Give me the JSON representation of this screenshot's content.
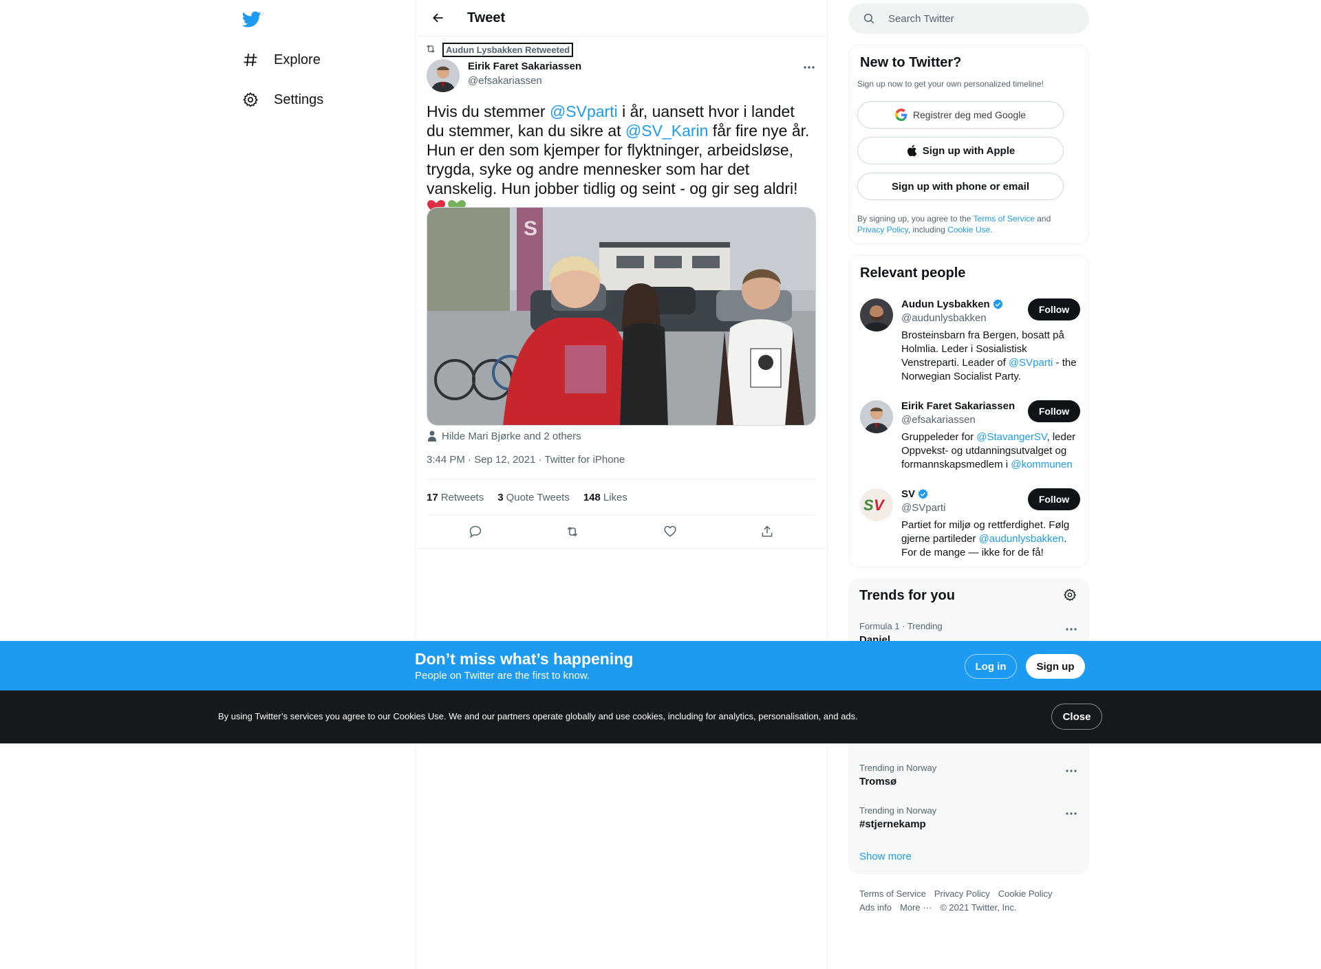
{
  "nav": {
    "logo": "twitter-bird-icon",
    "items": [
      {
        "label": "Explore",
        "icon": "hashtag-icon"
      },
      {
        "label": "Settings",
        "icon": "gear-icon"
      }
    ]
  },
  "header": {
    "title": "Tweet"
  },
  "tweet": {
    "retweeted_by": "Audun Lysbakken Retweeted",
    "author_name": "Eirik Faret Sakariassen",
    "author_handle": "@efsakariassen",
    "text_parts": [
      "Hvis du stemmer ",
      "@SVparti",
      " i år, uansett hvor i landet du stemmer, kan du sikre at ",
      "@SV_Karin",
      " får fire nye år. Hun er den som kjemper for flyktninger, arbeidsløse, trygda, syke og andre mennesker som har det vanskelig. Hun jobber tidlig og seint - og gir seg aldri! "
    ],
    "emoji": "❤️💚",
    "tagged": "Hilde Mari Bjørke and 2 others",
    "meta": "3:44 PM · Sep 12, 2021 · Twitter for iPhone",
    "stats": {
      "retweets_num": "17",
      "retweets_label": "Retweets",
      "quotes_num": "3",
      "quotes_label": "Quote Tweets",
      "likes_num": "148",
      "likes_label": "Likes"
    }
  },
  "search": {
    "placeholder": "Search Twitter"
  },
  "signup_panel": {
    "title": "New to Twitter?",
    "subtitle": "Sign up now to get your own personalized timeline!",
    "google_label": "Registrer deg med Google",
    "apple_label": "Sign up with Apple",
    "phone_label": "Sign up with phone or email",
    "legal_1": "By signing up, you agree to the ",
    "legal_tos": "Terms of Service",
    "legal_2": " and ",
    "legal_privacy": "Privacy Policy",
    "legal_3": ", including ",
    "legal_cookie": "Cookie Use."
  },
  "relevant": {
    "title": "Relevant people",
    "follow_label": "Follow",
    "people": [
      {
        "name": "Audun Lysbakken",
        "handle": "@audunlysbakken",
        "verified": true,
        "bio": [
          "Brosteinsbarn fra Bergen, bosatt på Holmlia. Leder i Sosialistisk Venstreparti. Leader of ",
          "@SVparti",
          " - the Norwegian Socialist Party."
        ]
      },
      {
        "name": "Eirik Faret Sakariassen",
        "handle": "@efsakariassen",
        "verified": false,
        "bio": [
          "Gruppeleder for ",
          "@StavangerSV",
          ", leder Oppvekst- og utdanningsutvalget og formannskapsmedlem i ",
          "@kommunen"
        ]
      },
      {
        "name": "SV",
        "handle": "@SVparti",
        "verified": true,
        "bio": [
          "Partiet for miljø og rettferdighet. Følg gjerne partileder ",
          "@audunlysbakken",
          ". For de mange — ikke for de få!"
        ]
      }
    ]
  },
  "trends": {
    "title": "Trends for you",
    "items": [
      {
        "context": "Formula 1 · Trending",
        "name": "Daniel"
      },
      {
        "context": "Trending in Norway",
        "name": "Tromsø"
      },
      {
        "context": "Trending in Norway",
        "name": "#stjernekamp"
      }
    ],
    "show_more": "Show more"
  },
  "footer": {
    "links": [
      "Terms of Service",
      "Privacy Policy",
      "Cookie Policy",
      "Ads info",
      "More ···",
      "© 2021 Twitter, Inc."
    ]
  },
  "bottom_bar": {
    "title": "Don’t miss what’s happening",
    "subtitle": "People on Twitter are the first to know.",
    "login": "Log in",
    "signup": "Sign up"
  },
  "cookie_bar": {
    "text": "By using Twitter’s services you agree to our Cookies Use. We and our partners operate globally and use cookies, including for analytics, personalisation, and ads.",
    "close": "Close"
  },
  "colors": {
    "accent": "#1d9bf0",
    "text": "#0f1419",
    "muted": "#536471",
    "cookie_bg": "#15191c"
  }
}
